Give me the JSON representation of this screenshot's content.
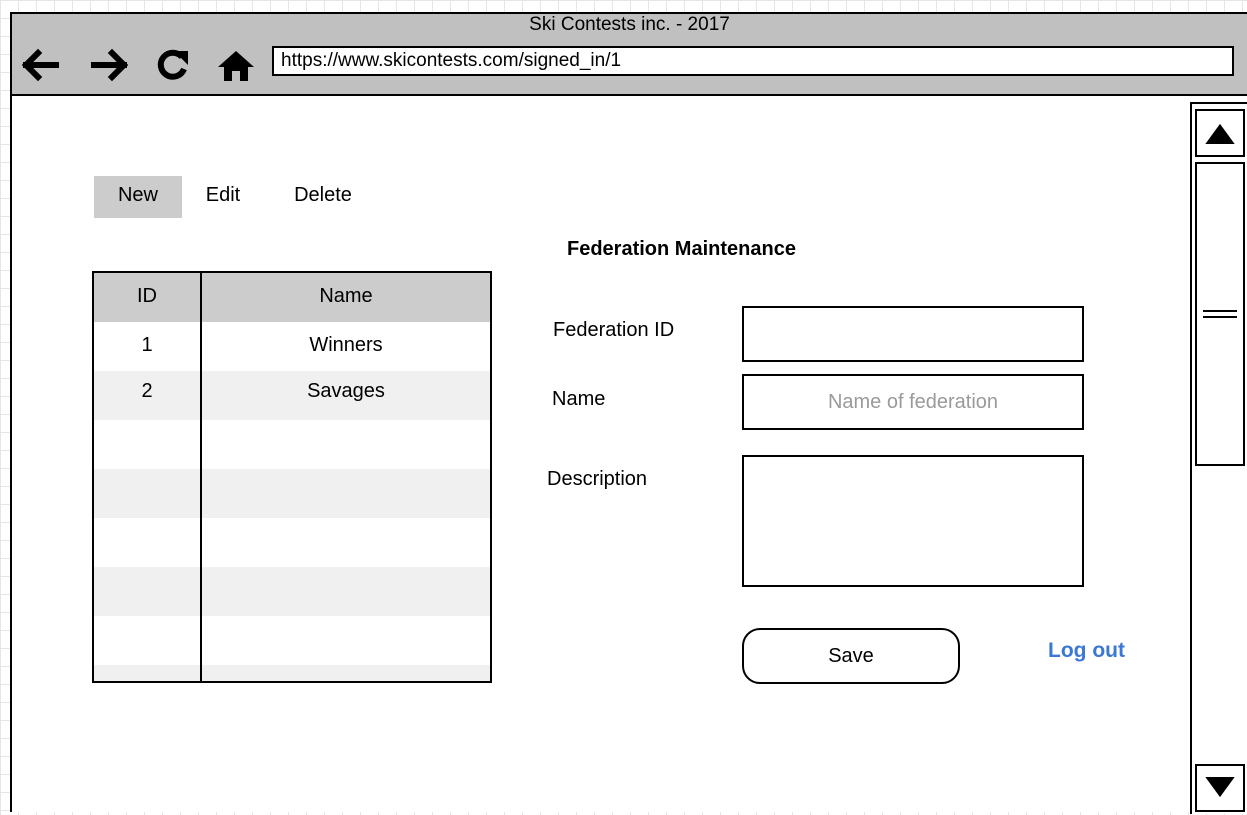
{
  "browser": {
    "title": "Ski Contests inc. - 2017",
    "url": "https://www.skicontests.com/signed_in/1"
  },
  "toolbar": {
    "new_label": "New",
    "edit_label": "Edit",
    "delete_label": "Delete"
  },
  "grid": {
    "columns": [
      "ID",
      "Name"
    ],
    "rows": [
      {
        "id": "1",
        "name": "Winners"
      },
      {
        "id": "2",
        "name": "Savages"
      }
    ]
  },
  "form": {
    "title": "Federation Maintenance",
    "federation_id_label": "Federation ID",
    "federation_id_value": "",
    "name_label": "Name",
    "name_placeholder": "Name of federation",
    "description_label": "Description",
    "description_value": "",
    "save_label": "Save",
    "logout_label": "Log out"
  },
  "colors": {
    "link": "#3b78d4",
    "titlebar": "#c0c0c0",
    "header_row": "#cccccc",
    "stripe_row": "#f0f0f0"
  },
  "icons": [
    "back-arrow-icon",
    "forward-arrow-icon",
    "refresh-icon",
    "home-icon",
    "scroll-up-icon",
    "scroll-down-icon"
  ]
}
